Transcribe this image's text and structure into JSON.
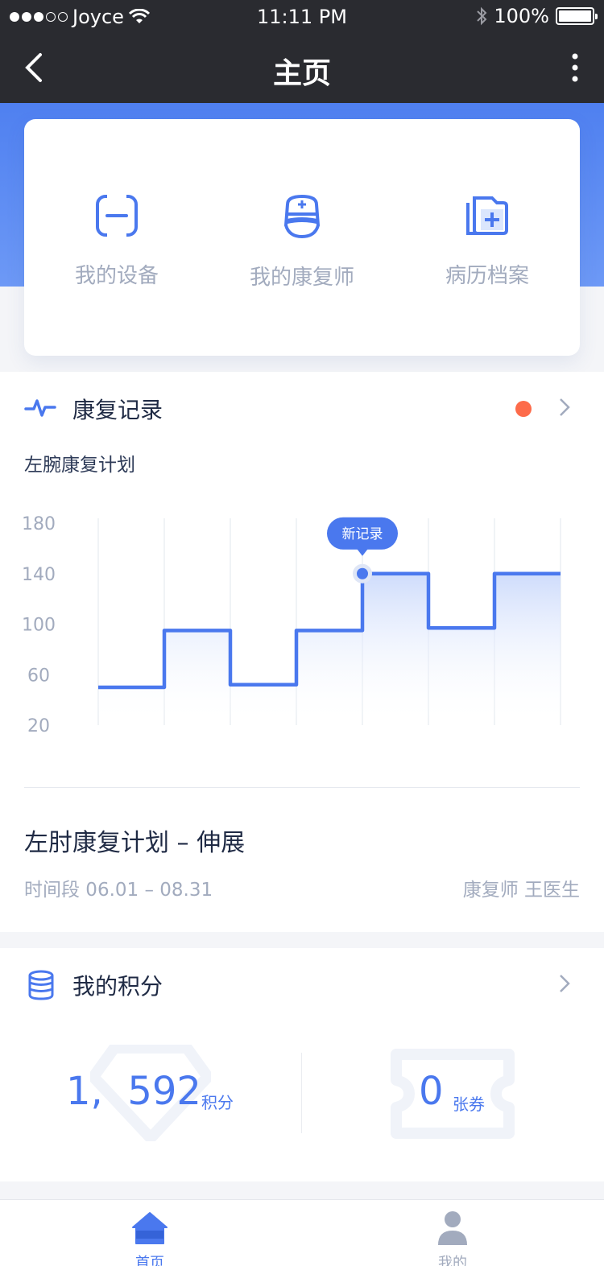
{
  "status_bar": {
    "carrier": "Joyce",
    "time": "11:11 PM",
    "battery": "100%"
  },
  "nav": {
    "title": "主页"
  },
  "quick_entries": [
    {
      "label": "我的设备",
      "icon": "device-scan-icon"
    },
    {
      "label": "我的康复师",
      "icon": "nurse-icon"
    },
    {
      "label": "病历档案",
      "icon": "medical-records-icon"
    }
  ],
  "recovery": {
    "section_title": "康复记录",
    "plan_name": "左腕康复计划",
    "tooltip": "新记录",
    "plan_title": "左肘康复计划 – 伸展",
    "period": "时间段 06.01 – 08.31",
    "doctor": "康复师 王医生"
  },
  "chart_data": {
    "type": "line",
    "step": true,
    "x_ticks": [
      0,
      5,
      10,
      15,
      20,
      25,
      30,
      35
    ],
    "y_ticks": [
      180,
      140,
      100,
      60,
      20
    ],
    "ylim": [
      20,
      180
    ],
    "xlim": [
      0,
      35
    ],
    "grid": "vertical",
    "series": [
      {
        "x": [
          0,
          5,
          5,
          10,
          10,
          15,
          15,
          20,
          20,
          25,
          25,
          30,
          30,
          35
        ],
        "y": [
          50,
          50,
          95,
          95,
          52,
          52,
          95,
          95,
          140,
          140,
          97,
          97,
          140,
          140
        ],
        "color": "#4a78ee"
      }
    ],
    "highlight": {
      "x": 20,
      "y": 140
    }
  },
  "points": {
    "section_title": "我的积分",
    "points_value": "1,  592",
    "points_unit": "积分",
    "coupon_value": "0",
    "coupon_unit": "张券"
  },
  "tabbar": {
    "home": "首页",
    "mine": "我的"
  },
  "colors": {
    "accent": "#4a78ee",
    "dark_bar": "#2a2b30",
    "badge_red": "#fd6b4a"
  }
}
